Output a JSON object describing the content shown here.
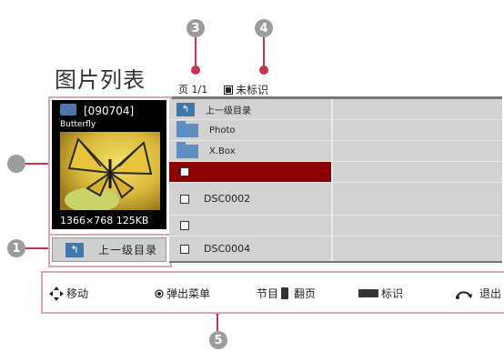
{
  "page_title": "图片列表",
  "page_number": "页 1/1",
  "unmarked_label": "未标识",
  "callouts": [
    "1",
    "3",
    "4",
    "5"
  ],
  "preview": {
    "name": "[090704]",
    "title": "Butterfly",
    "size_info": "1366×768  125KB"
  },
  "up_button": {
    "icon": "↰",
    "label": "上一级目录"
  },
  "list": {
    "rows": [
      {
        "kind": "up",
        "label": "上一级目录"
      },
      {
        "kind": "folder",
        "label": "Photo"
      },
      {
        "kind": "folder",
        "label": "X.Box"
      },
      {
        "kind": "file",
        "label": ""
      },
      {
        "kind": "file",
        "label": "DSC0002"
      },
      {
        "kind": "file",
        "label": ""
      },
      {
        "kind": "file",
        "label": "DSC0004"
      }
    ],
    "selected_index": 3
  },
  "help": {
    "move": "移动",
    "popup_menu": "弹出菜单",
    "page_prefix": "节目",
    "page_turn": "翻页",
    "mark": "标识",
    "exit": "退出"
  },
  "colors": {
    "accent": "#c8334d",
    "selected": "#8b0000",
    "frame": "#d9a9b3",
    "folder": "#5f8fc0"
  }
}
